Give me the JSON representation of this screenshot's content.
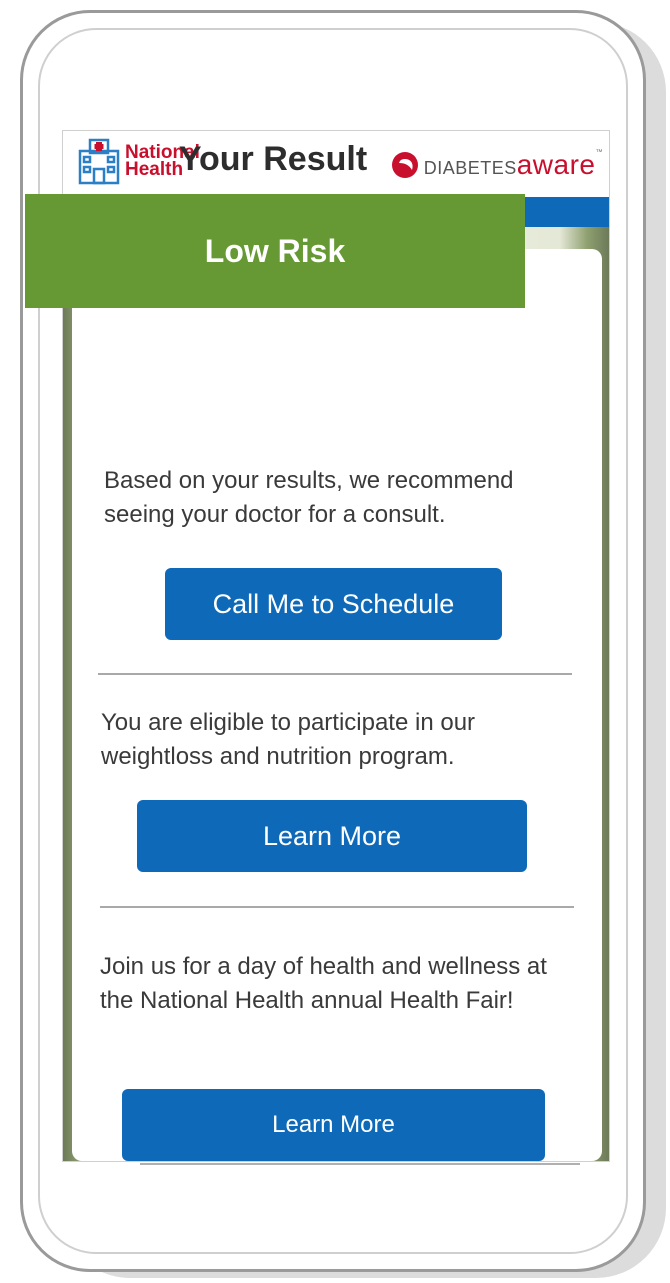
{
  "header": {
    "brand_line1": "National",
    "brand_line2": "Health",
    "partner_prefix": "DIABETES",
    "partner_suffix": "aware",
    "partner_mark": "™"
  },
  "result": {
    "title": "Your Result",
    "risk_label": "Low Risk"
  },
  "sections": [
    {
      "text": "Based on your results, we recommend seeing your doctor for a consult.",
      "button": "Call Me to Schedule"
    },
    {
      "text": "You are eligible to participate in our weightloss and nutrition program.",
      "button": "Learn More"
    },
    {
      "text": "Join us for a day of health and wellness at the National Health annual Health Fair!",
      "button": "Learn More"
    }
  ],
  "colors": {
    "brand_red": "#c8102e",
    "primary_blue": "#0e6ab8",
    "risk_green": "#669933"
  },
  "icons": [
    "hospital-icon",
    "diabetes-aware-swoosh-icon"
  ]
}
